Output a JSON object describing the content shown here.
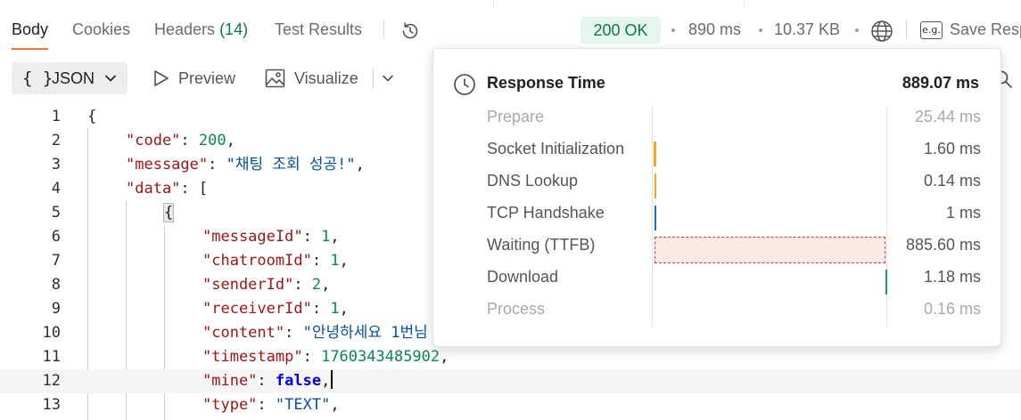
{
  "tabs": [
    {
      "label": "Body"
    },
    {
      "label": "Cookies"
    },
    {
      "label": "Headers",
      "count": "(14)"
    },
    {
      "label": "Test Results"
    }
  ],
  "response": {
    "status": "200 OK",
    "time": "890 ms",
    "size": "10.37 KB",
    "save_label": "Save Resp",
    "eg_glyph": "e.g."
  },
  "toolbar": {
    "format_braces": "{ }",
    "format_label": "JSON",
    "preview_label": "Preview",
    "visualize_label": "Visualize"
  },
  "editor": {
    "current_line": 12,
    "lines": [
      {
        "num": "1"
      },
      {
        "num": "2"
      },
      {
        "num": "3"
      },
      {
        "num": "4"
      },
      {
        "num": "5"
      },
      {
        "num": "6"
      },
      {
        "num": "7"
      },
      {
        "num": "8"
      },
      {
        "num": "9"
      },
      {
        "num": "10"
      },
      {
        "num": "11"
      },
      {
        "num": "12"
      },
      {
        "num": "13"
      }
    ],
    "tokens": {
      "l1_brace": "{",
      "code_key": "\"code\"",
      "code_val": "200",
      "message_key": "\"message\"",
      "message_val": "\"채팅 조회 성공!\"",
      "data_key": "\"data\"",
      "data_open": "[",
      "obj_open": "{",
      "messageId_key": "\"messageId\"",
      "messageId_val": "1",
      "chatroomId_key": "\"chatroomId\"",
      "chatroomId_val": "1",
      "senderId_key": "\"senderId\"",
      "senderId_val": "2",
      "receiverId_key": "\"receiverId\"",
      "receiverId_val": "1",
      "content_key": "\"content\"",
      "content_val": "\"안녕하세요 1번님",
      "timestamp_key": "\"timestamp\"",
      "timestamp_val": "1760343485902",
      "mine_key": "\"mine\"",
      "mine_val": "false",
      "type_key": "\"type\"",
      "type_val": "\"TEXT\""
    }
  },
  "timing_popup": {
    "title": "Response Time",
    "total": "889.07 ms",
    "phases": [
      {
        "name": "Prepare",
        "time": "25.44 ms",
        "muted": true,
        "start": 0,
        "duration": 25.44
      },
      {
        "name": "Socket Initialization",
        "time": "1.60 ms",
        "muted": false,
        "start": 0,
        "duration": 1.6,
        "color": "#f5a623"
      },
      {
        "name": "DNS Lookup",
        "time": "0.14 ms",
        "muted": false,
        "start": 1.6,
        "duration": 0.14,
        "color": "#f5a623"
      },
      {
        "name": "TCP Handshake",
        "time": "1 ms",
        "muted": false,
        "start": 1.74,
        "duration": 1,
        "color": "#1f6fd1"
      },
      {
        "name": "Waiting (TTFB)",
        "time": "885.60 ms",
        "muted": false,
        "start": 2.74,
        "duration": 885.6,
        "color": "#d93b3b"
      },
      {
        "name": "Download",
        "time": "1.18 ms",
        "muted": false,
        "start": 888.34,
        "duration": 1.18,
        "color": "#1e9e5a"
      },
      {
        "name": "Process",
        "time": "0.16 ms",
        "muted": true,
        "start": 889.52,
        "duration": 0.16
      }
    ]
  },
  "colors": {
    "accent": "#ff6c37",
    "status_green": "#0c7a43",
    "status_bg": "#e5f6ec"
  },
  "icons": {
    "history": "history-icon",
    "globe": "globe-icon",
    "preview": "play-outline-icon",
    "visualize": "image-icon",
    "clock": "clock-icon"
  }
}
